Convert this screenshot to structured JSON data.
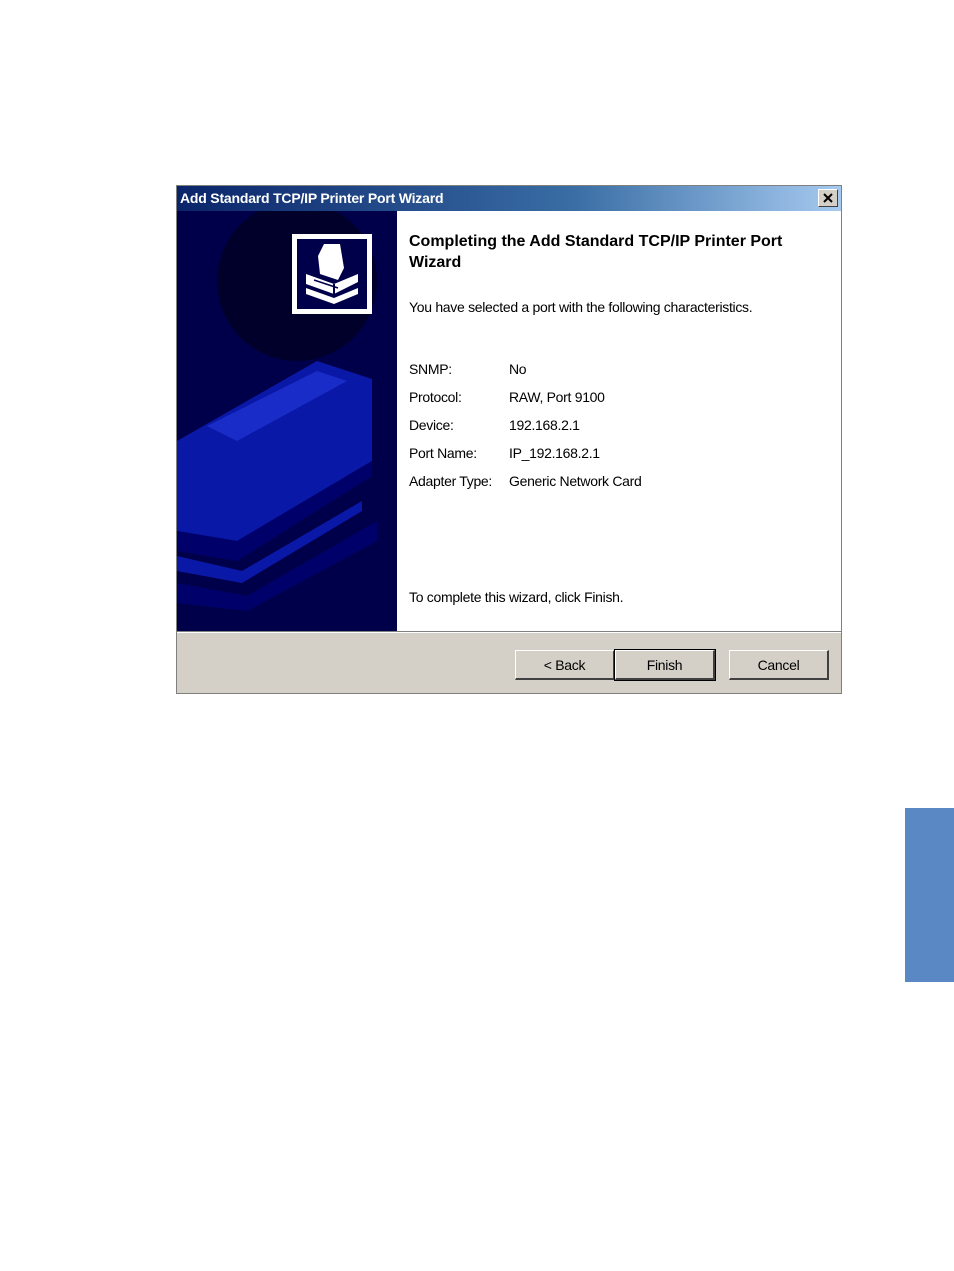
{
  "window": {
    "title": "Add Standard TCP/IP Printer Port Wizard",
    "close_glyph": "✕"
  },
  "wizard": {
    "heading": "Completing the Add Standard TCP/IP Printer Port Wizard",
    "intro": "You have selected a port with the following characteristics.",
    "properties": [
      {
        "label": "SNMP:",
        "value": "No"
      },
      {
        "label": "Protocol:",
        "value": "RAW, Port 9100"
      },
      {
        "label": "Device:",
        "value": "192.168.2.1"
      },
      {
        "label": "Port Name:",
        "value": "IP_192.168.2.1"
      },
      {
        "label": "Adapter Type:",
        "value": "Generic Network Card"
      }
    ],
    "complete_text": "To complete this wizard, click Finish."
  },
  "buttons": {
    "back_label": "< Back",
    "finish_label": "Finish",
    "cancel_label": "Cancel"
  },
  "icons": {
    "wizard_graphic": "printer-icon",
    "close": "close-icon"
  },
  "colors": {
    "titlebar_start": "#0a246a",
    "side_panel": "#00004a",
    "page_tab": "#5a88c4"
  }
}
